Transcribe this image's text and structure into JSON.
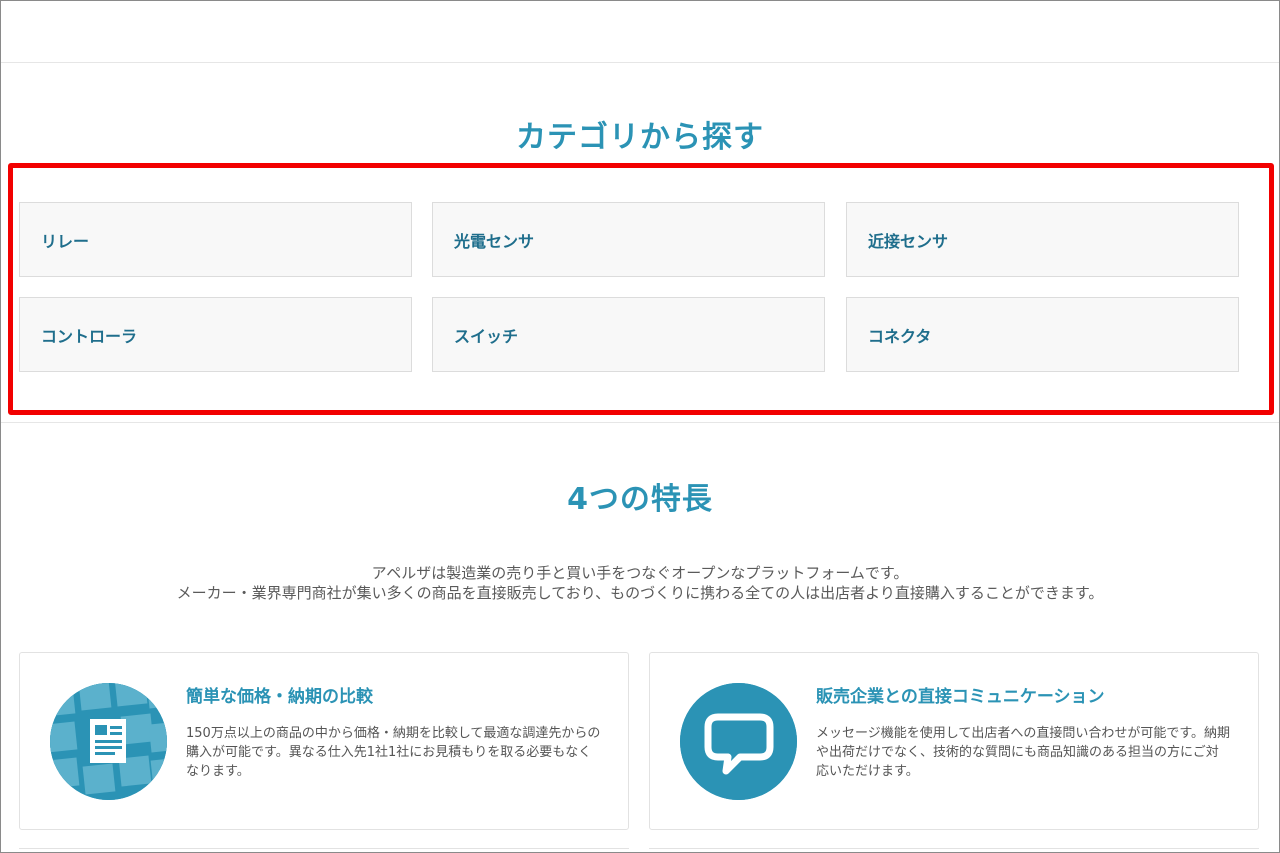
{
  "categories_section": {
    "title": "カテゴリから探す",
    "items": [
      {
        "label": "リレー"
      },
      {
        "label": "光電センサ"
      },
      {
        "label": "近接センサ"
      },
      {
        "label": "コントローラ"
      },
      {
        "label": "スイッチ"
      },
      {
        "label": "コネクタ"
      }
    ]
  },
  "features_section": {
    "title": "4つの特長",
    "intro_line1": "アペルザは製造業の売り手と買い手をつなぐオープンなプラットフォームです。",
    "intro_line2": "メーカー・業界専門商社が集い多くの商品を直接販売しており、ものづくりに携わる全ての人は出店者より直接購入することができます。",
    "features": [
      {
        "title": "簡単な価格・納期の比較",
        "description": "150万点以上の商品の中から価格・納期を比較して最適な調達先からの購入が可能です。異なる仕入先1社1社にお見積もりを取る必要もなくなります。",
        "icon": "document-grid-icon"
      },
      {
        "title": "販売企業との直接コミュニケーション",
        "description": "メッセージ機能を使用して出店者への直接問い合わせが可能です。納期や出荷だけでなく、技術的な質問にも商品知識のある担当の方にご対応いただけます。",
        "icon": "speech-bubble-icon"
      }
    ]
  },
  "colors": {
    "accent": "#2b93b5",
    "category_text": "#1f6e8c",
    "highlight": "#f20000",
    "card_bg": "#f8f8f8"
  }
}
